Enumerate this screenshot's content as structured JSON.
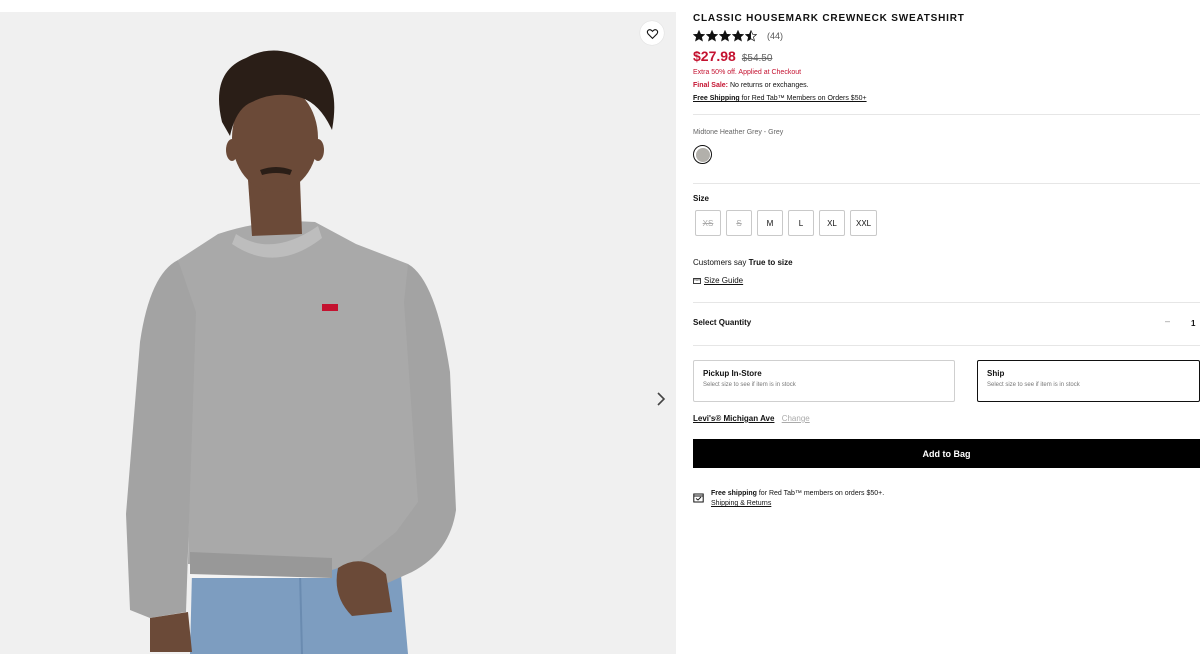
{
  "product": {
    "title": "Classic Housemark Crewneck Sweatshirt",
    "rating_value": 4.5,
    "review_count": "(44)",
    "sale_price": "$27.98",
    "original_price": "$54.50",
    "promo_text": "Extra 50% off. Applied at Checkout",
    "final_sale_label": "Final Sale:",
    "final_sale_text": " No returns or exchanges.",
    "free_shipping_bold": "Free Shipping",
    "free_shipping_text": " for Red Tab™ Members on Orders $50+"
  },
  "color": {
    "name": "Midtone Heather Grey - Grey",
    "swatch_hex": "#b2b0ab"
  },
  "size": {
    "label": "Size",
    "options": [
      {
        "label": "XS",
        "available": false
      },
      {
        "label": "S",
        "available": false
      },
      {
        "label": "M",
        "available": true
      },
      {
        "label": "L",
        "available": true
      },
      {
        "label": "XL",
        "available": true
      },
      {
        "label": "XXL",
        "available": true
      }
    ],
    "fit_prefix": "Customers say ",
    "fit_value": "True to size",
    "guide_label": "Size Guide"
  },
  "quantity": {
    "label": "Select Quantity",
    "minus": "–",
    "value": "1"
  },
  "fulfillment": {
    "pickup": {
      "title": "Pickup In-Store",
      "subtitle": "Select size to see if item is in stock"
    },
    "ship": {
      "title": "Ship",
      "subtitle": "Select size to see if item is in stock"
    }
  },
  "store": {
    "name": "Levi's® Michigan Ave",
    "change_label": "Change"
  },
  "cta": {
    "add_to_bag": "Add to Bag"
  },
  "shipping_info": {
    "bold": "Free shipping",
    "text": " for Red Tab™ members on orders $50+.",
    "link": "Shipping & Returns"
  },
  "icons": {
    "wishlist": "heart-icon",
    "next": "chevron-right-icon",
    "size_guide": "ruler-icon",
    "shipping": "delivery-box-icon"
  },
  "colors": {
    "sale_red": "#c41230",
    "cta_black": "#000000"
  }
}
